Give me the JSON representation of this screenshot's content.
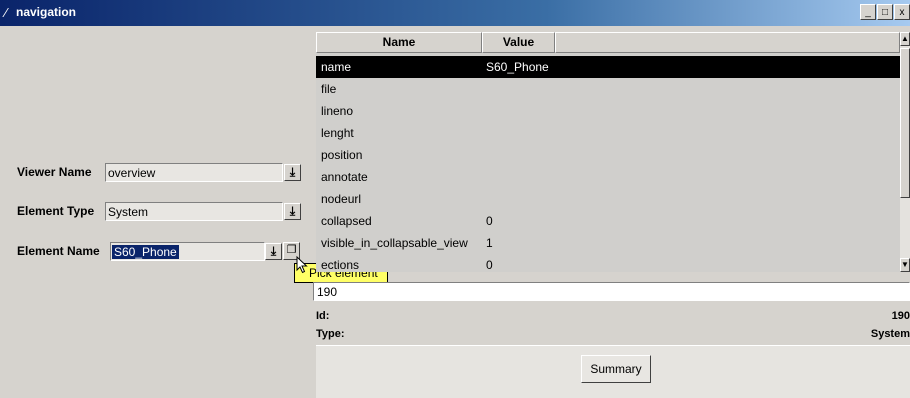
{
  "window": {
    "title": "navigation",
    "minimize": "_",
    "maximize": "□",
    "close": "x"
  },
  "form": {
    "viewer_name": {
      "label": "Viewer Name",
      "value": "overview"
    },
    "element_type": {
      "label": "Element Type",
      "value": "System"
    },
    "element_name": {
      "label": "Element Name",
      "value": "S60_Phone"
    },
    "pick_tooltip": "Pick element"
  },
  "table": {
    "headers": [
      "Name",
      "Value"
    ],
    "rows": [
      {
        "name": "name",
        "value": "S60_Phone"
      },
      {
        "name": "file",
        "value": ""
      },
      {
        "name": "lineno",
        "value": ""
      },
      {
        "name": "lenght",
        "value": ""
      },
      {
        "name": "position",
        "value": ""
      },
      {
        "name": "annotate",
        "value": ""
      },
      {
        "name": "nodeurl",
        "value": ""
      },
      {
        "name": "collapsed",
        "value": "0"
      },
      {
        "name": "visible_in_collapsable_view",
        "value": "1"
      },
      {
        "name": "ections",
        "value": "0"
      }
    ]
  },
  "id_field": {
    "value": "190"
  },
  "info": {
    "id_label": "Id:",
    "id_value": "190",
    "type_label": "Type:",
    "type_value": "System"
  },
  "summary_button": "Summary",
  "colors": {
    "titlebar": "#0a246a",
    "selection": "#000000",
    "tooltip": "#ffff66"
  },
  "icons": {
    "dropdown": "down-arrow-icon",
    "pick": "pick-element-icon"
  }
}
